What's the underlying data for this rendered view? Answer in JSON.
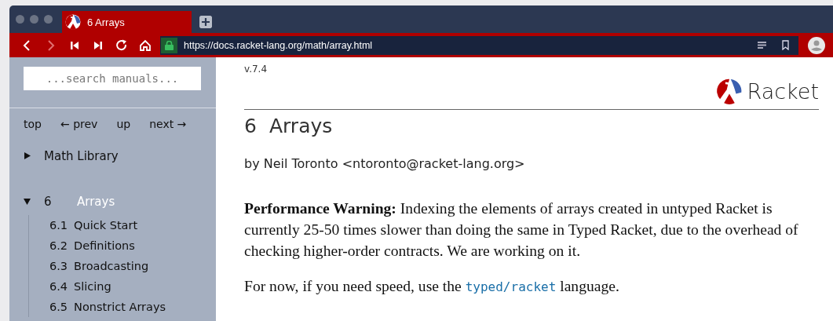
{
  "tabs": [
    {
      "title": "6 Arrays",
      "selected": true
    }
  ],
  "toolbar": {
    "buttons": [
      {
        "kind": "back",
        "disabled": false
      },
      {
        "kind": "forward",
        "disabled": true
      },
      {
        "kind": "first",
        "disabled": false
      },
      {
        "kind": "last",
        "disabled": false
      },
      {
        "kind": "reload",
        "disabled": false
      },
      {
        "kind": "home",
        "disabled": false
      }
    ],
    "url": "https://docs.racket-lang.org/math/array.html"
  },
  "sidebar": {
    "search": {
      "placeholder": "...search manuals..."
    },
    "nav": [
      "top",
      "← prev",
      "up",
      "next →"
    ],
    "toc": [
      {
        "title": "Math Library",
        "expanded": false,
        "selected": false
      },
      {
        "number": "6",
        "title": "Arrays",
        "expanded": true,
        "selected": true,
        "children": [
          {
            "number": "6.1",
            "title": "Quick Start",
            "selected": false
          },
          {
            "number": "6.2",
            "title": "Definitions",
            "selected": false
          },
          {
            "number": "6.3",
            "title": "Broadcasting",
            "selected": false
          },
          {
            "number": "6.4",
            "title": "Slicing",
            "selected": false
          },
          {
            "number": "6.5",
            "title": "Nonstrict Arrays",
            "selected": false
          }
        ]
      }
    ]
  },
  "content": {
    "version": "v.7.4",
    "logo": "Racket",
    "heading": {
      "number": "6",
      "title": "Arrays"
    },
    "author": "by Neil Toronto <ntoronto@racket-lang.org>",
    "paragraphs": [
      {
        "parts": [
          {
            "kind": "text",
            "text": "**Performance Warning:** Indexing the elements of arrays created in untyped Racket is currently 25-50 times slower than doing the same in Typed Racket, due to the overhead of checking higher-order contracts. We are working on it."
          }
        ]
      },
      {
        "parts": [
          {
            "kind": "text",
            "text": "For now, if you need speed, use the "
          },
          {
            "kind": "link",
            "text": "typed/racket"
          },
          {
            "kind": "text",
            "text": " language."
          }
        ]
      }
    ]
  }
}
